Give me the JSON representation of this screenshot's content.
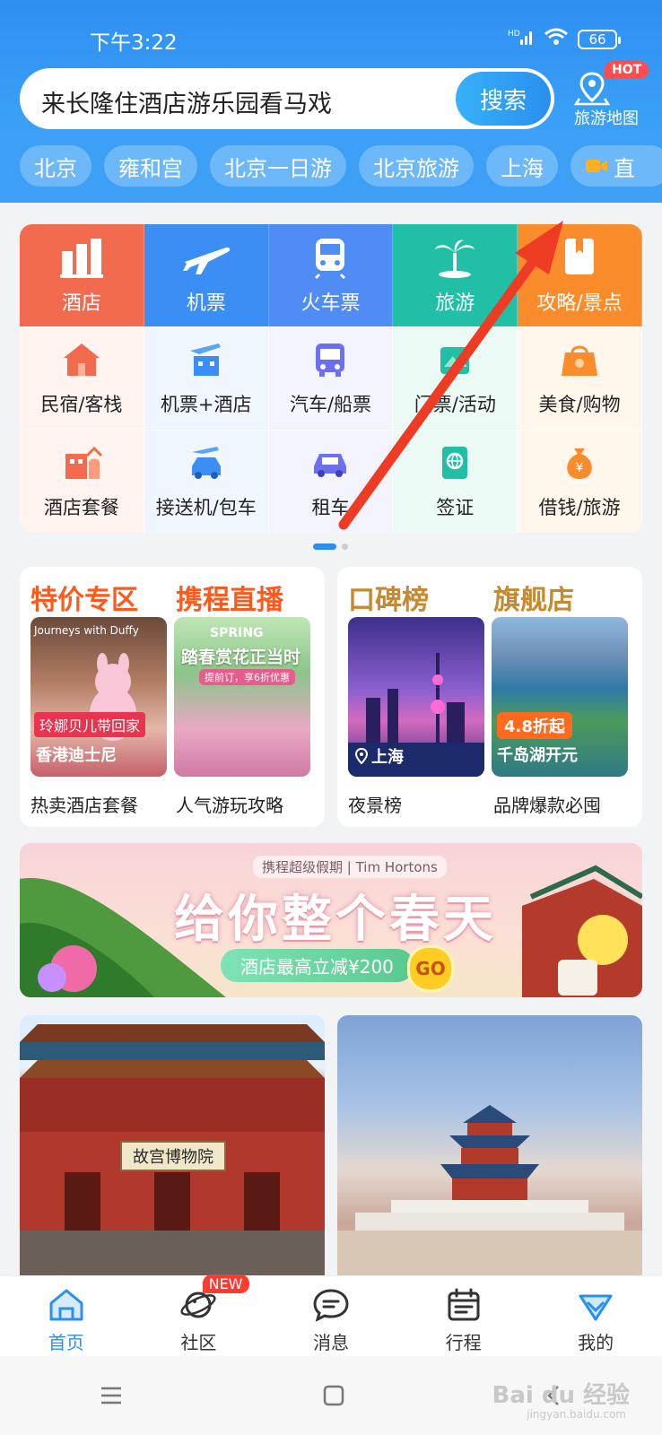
{
  "status": {
    "time": "下午3:22",
    "network": "HD",
    "battery": "66"
  },
  "search": {
    "text": "来长隆住酒店游乐园看马戏",
    "button": "搜索"
  },
  "map": {
    "label": "旅游地图",
    "badge": "HOT"
  },
  "chips": [
    "北京",
    "雍和宫",
    "北京一日游",
    "北京旅游",
    "上海",
    "直"
  ],
  "main_row": [
    {
      "label": "酒店",
      "color": "#f26b4f"
    },
    {
      "label": "机票",
      "color": "#3b8ef3"
    },
    {
      "label": "火车票",
      "color": "#4f8cf5"
    },
    {
      "label": "旅游",
      "color": "#20bfa6"
    },
    {
      "label": "攻略/景点",
      "color": "#fb8c2c"
    }
  ],
  "sub_rows": [
    [
      {
        "label": "民宿/客栈"
      },
      {
        "label": "机票+酒店"
      },
      {
        "label": "汽车/船票"
      },
      {
        "label": "门票/活动"
      },
      {
        "label": "美食/购物"
      }
    ],
    [
      {
        "label": "酒店套餐"
      },
      {
        "label": "接送机/包车"
      },
      {
        "label": "租车"
      },
      {
        "label": "签证"
      },
      {
        "label": "借钱/旅游"
      }
    ]
  ],
  "promo_left": {
    "title1": "特价专区",
    "title2": "携程直播",
    "img1_text1": "Journeys with Duffy",
    "img1_tag": "玲娜贝儿带回家",
    "img1_sub": "香港迪士尼",
    "img2_text1": "SPRING",
    "img2_text2": "踏春赏花正当时",
    "img2_text3": "提前订，享6折优惠",
    "cap1": "热卖酒店套餐",
    "cap2": "人气游玩攻略"
  },
  "promo_right": {
    "title1": "口碑榜",
    "title2": "旗舰店",
    "img3_loc": "上海",
    "img4_tag": "4.8折起",
    "img4_sub": "千岛湖开元",
    "cap3": "夜景榜",
    "cap4": "品牌爆款必囤"
  },
  "banner": {
    "brand": "携程超级假期 | Tim Hortons",
    "title": "给你整个春天",
    "pill": "酒店最高立减¥200",
    "go": "GO"
  },
  "feed": {
    "left_sign": "故宫博物院"
  },
  "tabs": [
    {
      "label": "首页",
      "active": true
    },
    {
      "label": "社区",
      "badge": "NEW"
    },
    {
      "label": "消息"
    },
    {
      "label": "行程"
    },
    {
      "label": "我的"
    }
  ],
  "watermark": {
    "main": "Bai du 经验",
    "sub": "jingyan.baidu.com"
  }
}
